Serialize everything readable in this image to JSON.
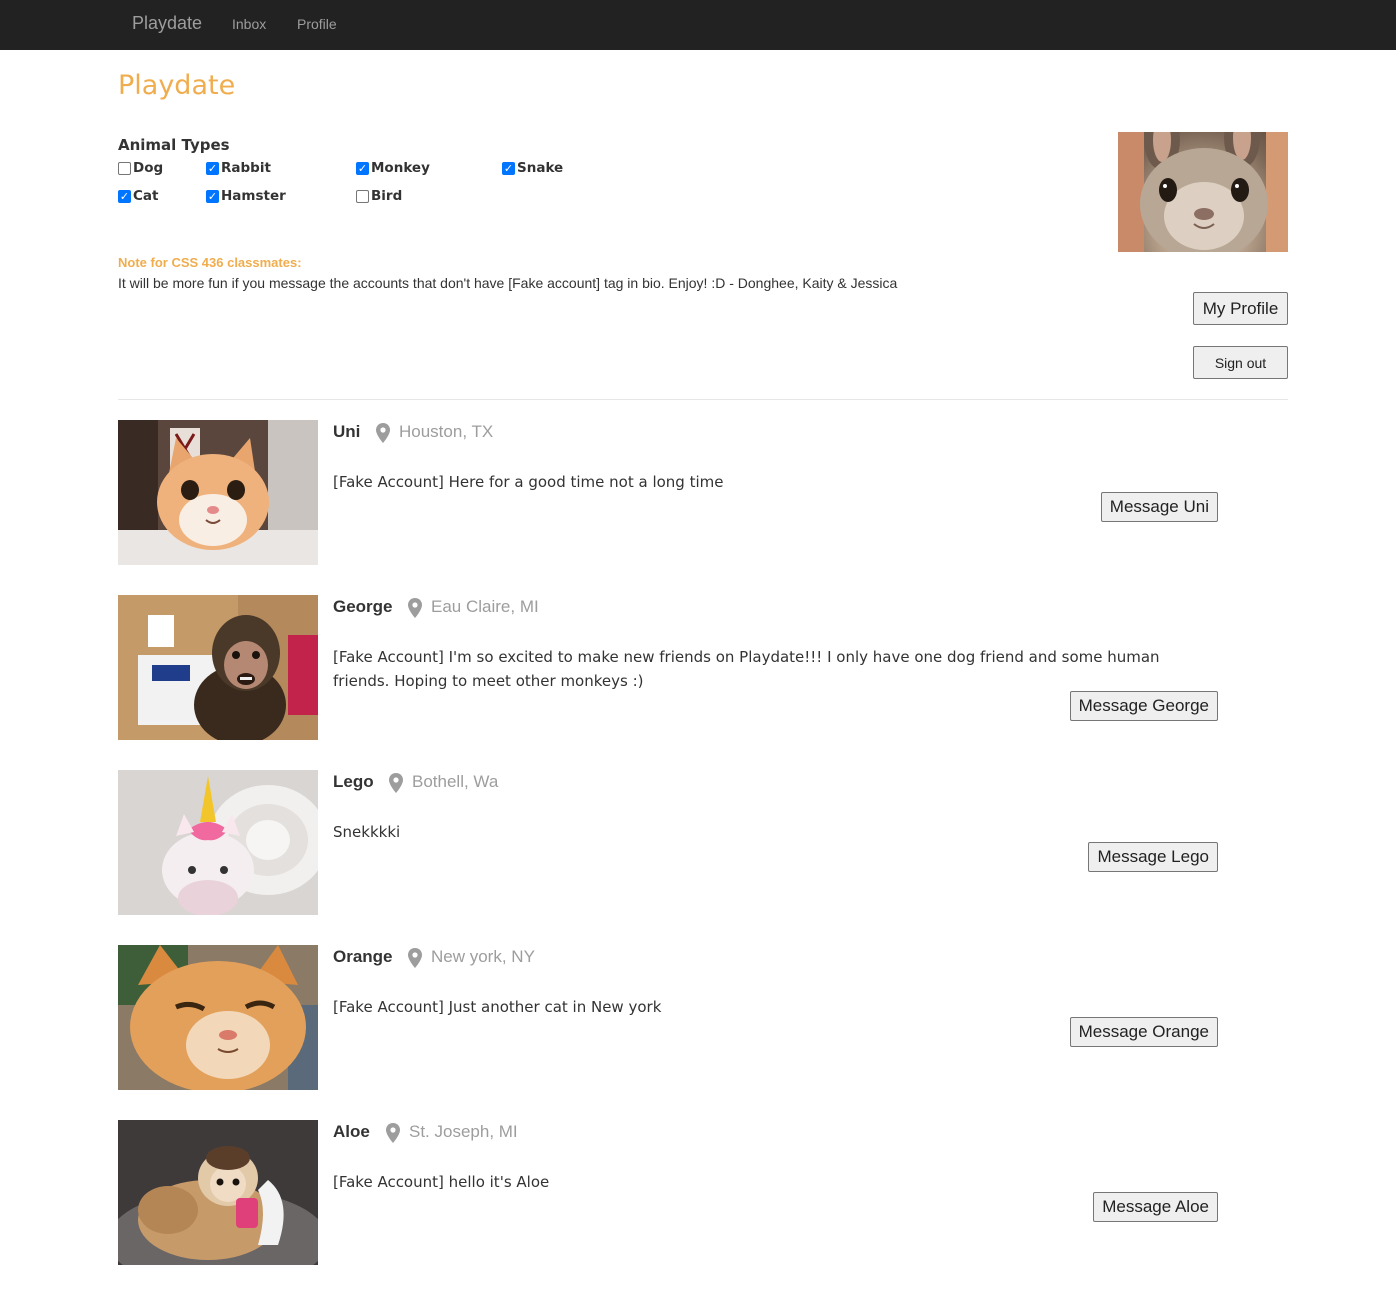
{
  "navbar": {
    "brand": "Playdate",
    "links": [
      "Inbox",
      "Profile"
    ]
  },
  "page_title": "Playdate",
  "filters": {
    "heading": "Animal Types",
    "options": [
      {
        "label": "Dog",
        "checked": false
      },
      {
        "label": "Rabbit",
        "checked": true
      },
      {
        "label": "Monkey",
        "checked": true
      },
      {
        "label": "Snake",
        "checked": true
      },
      {
        "label": "Cat",
        "checked": true
      },
      {
        "label": "Hamster",
        "checked": true
      },
      {
        "label": "Bird",
        "checked": false
      }
    ]
  },
  "note": {
    "title": "Note for CSS 436 classmates:",
    "text": "It will be more fun if you message the accounts that don't have [Fake account] tag in bio. Enjoy! :D - Donghee, Kaity & Jessica"
  },
  "account": {
    "photo_icon": "rabbit-photo",
    "my_profile_label": "My Profile",
    "sign_out_label": "Sign out"
  },
  "profiles": [
    {
      "name": "Uni",
      "location": "Houston, TX",
      "bio": "[Fake Account] Here for a good time not a long time",
      "button": "Message Uni",
      "photo_icon": "cat-photo"
    },
    {
      "name": "George",
      "location": "Eau Claire, MI",
      "bio": "[Fake Account] I'm so excited to make new friends on Playdate!!! I only have one dog friend and some human friends. Hoping to meet other monkeys :)",
      "button": "Message George",
      "photo_icon": "monkey-photo"
    },
    {
      "name": "Lego",
      "location": "Bothell, Wa",
      "bio": "Snekkkki",
      "button": "Message Lego",
      "photo_icon": "snake-photo"
    },
    {
      "name": "Orange",
      "location": "New york, NY",
      "bio": "[Fake Account] Just another cat in New york",
      "button": "Message Orange",
      "photo_icon": "cat-photo"
    },
    {
      "name": "Aloe",
      "location": "St. Joseph, MI",
      "bio": "[Fake Account] hello it's Aloe",
      "button": "Message Aloe",
      "photo_icon": "monkey-photo"
    }
  ],
  "colors": {
    "navbar": "#222222",
    "accent": "#f0ad4e",
    "muted": "#9d9d9d",
    "checkbox": "#0075ff"
  }
}
